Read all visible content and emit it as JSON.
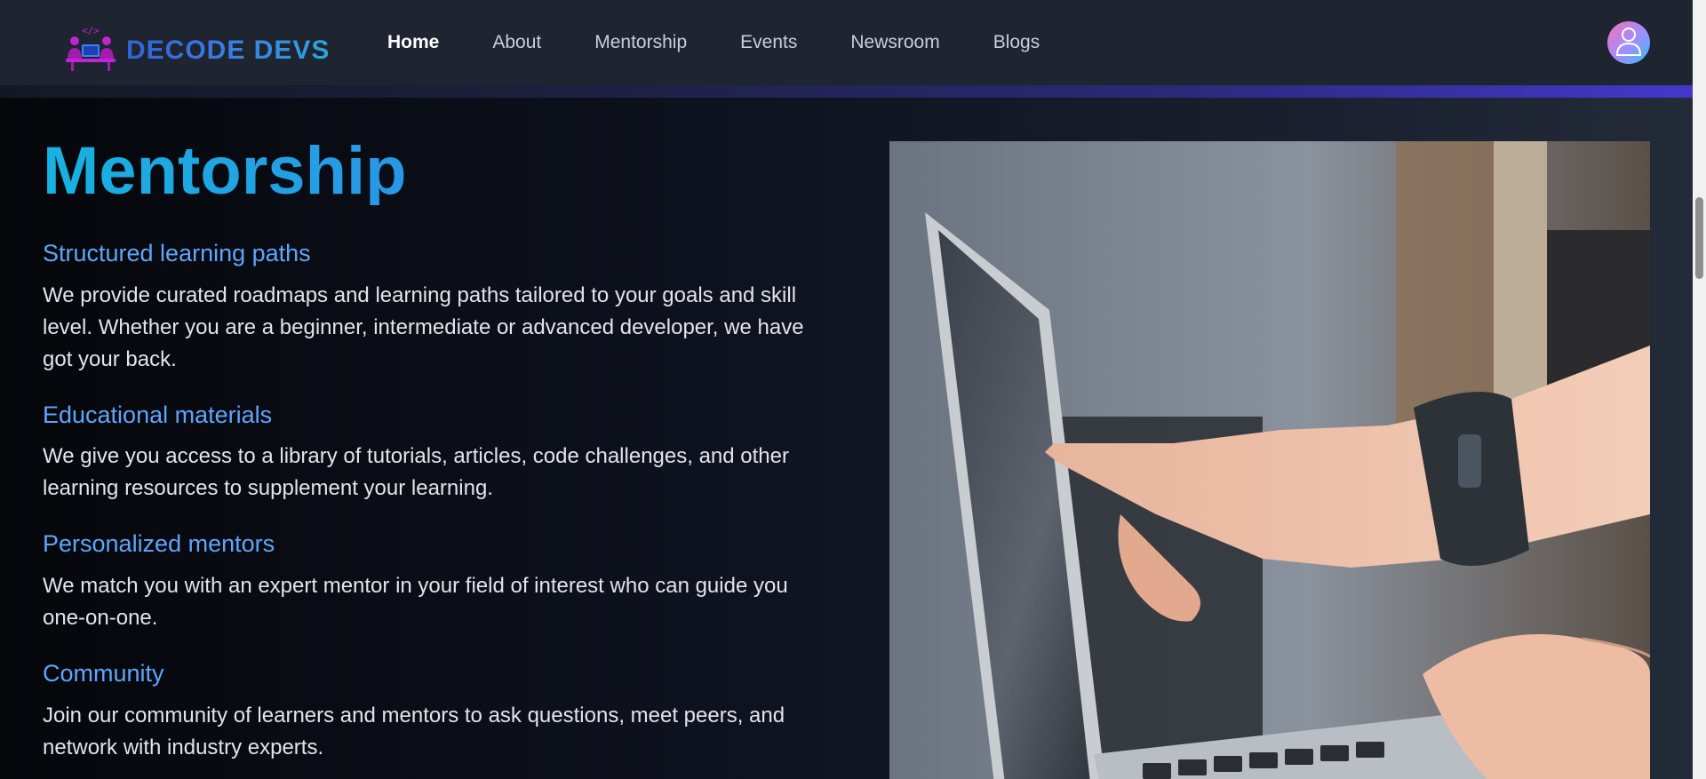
{
  "brand": {
    "name": "DECODE DEVS",
    "logo_icon": "two-developers-at-laptop-icon"
  },
  "nav": {
    "items": [
      {
        "label": "Home",
        "active": true
      },
      {
        "label": "About",
        "active": false
      },
      {
        "label": "Mentorship",
        "active": false
      },
      {
        "label": "Events",
        "active": false
      },
      {
        "label": "Newsroom",
        "active": false
      },
      {
        "label": "Blogs",
        "active": false
      }
    ],
    "avatar_icon": "user-avatar-icon"
  },
  "page": {
    "title": "Mentorship",
    "features": [
      {
        "heading": "Structured learning paths",
        "text": "We provide curated roadmaps and learning paths tailored to your goals and skill level. Whether you are a beginner, intermediate or advanced developer, we have got your back."
      },
      {
        "heading": "Educational materials",
        "text": "We give you access to a library of tutorials, articles, code challenges, and other learning resources to supplement your learning."
      },
      {
        "heading": "Personalized mentors",
        "text": "We match you with an expert mentor in your field of interest who can guide you one-on-one."
      },
      {
        "heading": "Community",
        "text": "Join our community of learners and mentors to ask questions, meet peers, and network with industry experts."
      }
    ]
  },
  "colors": {
    "accent": "#60a5fa",
    "title_gradient_start": "#17b2e0",
    "nav_background": "#1e2430",
    "accent_bar": "#4338ca"
  }
}
